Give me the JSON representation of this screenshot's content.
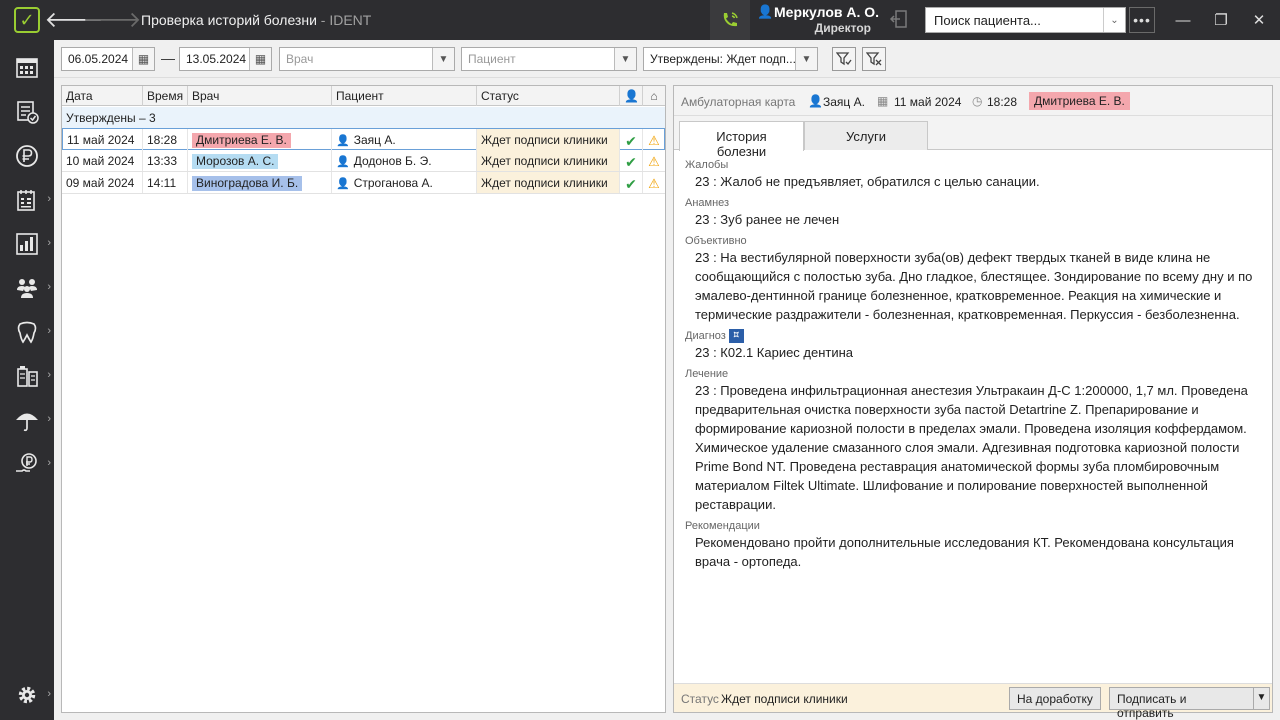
{
  "titlebar": {
    "back_glyph": "🡐",
    "forward_glyph": "🡒",
    "title": "Проверка историй болезни",
    "app_suffix": " - IDENT",
    "user_name": "Меркулов А. О.",
    "user_role": "Директор",
    "search_placeholder": "Поиск пациента...",
    "more_glyph": "•••",
    "min_glyph": "—",
    "max_glyph": "❐",
    "close_glyph": "✕"
  },
  "filters": {
    "date_from": "06.05.2024",
    "date_to": "13.05.2024",
    "dash": "—",
    "doctor_placeholder": "Врач",
    "patient_placeholder": "Пациент",
    "status_value": "Утверждены: Ждет подп..."
  },
  "table": {
    "headers": {
      "date": "Дата",
      "time": "Время",
      "doctor": "Врач",
      "patient": "Пациент",
      "status": "Статус"
    },
    "group": "Утверждены – 3",
    "rows": [
      {
        "date": "11 май 2024",
        "time": "18:28",
        "doctor": "Дмитриева Е. В.",
        "doctor_color": "#f4a7ad",
        "patient": "Заяц А.",
        "status": "Ждет подписи клиники"
      },
      {
        "date": "10 май 2024",
        "time": "13:33",
        "doctor": "Морозов А. С.",
        "doctor_color": "#b5dcf2",
        "patient": "Додонов Б. Э.",
        "status": "Ждет подписи клиники"
      },
      {
        "date": "09 май 2024",
        "time": "14:11",
        "doctor": "Виноградова И. Б.",
        "doctor_color": "#a6c0ea",
        "patient": "Строганова А.",
        "status": "Ждет подписи клиники"
      }
    ]
  },
  "detail": {
    "card_label": "Амбулаторная карта",
    "patient": "Заяц А.",
    "date": "11 май 2024",
    "time": "18:28",
    "doctor": "Дмитриева Е. В.",
    "tabs": [
      "История болезни",
      "Услуги"
    ],
    "sections": [
      {
        "title": "Жалобы",
        "body": "23 : Жалоб не предъявляет, обратился с целью санации."
      },
      {
        "title": "Анамнез",
        "body": "23 : Зуб ранее не лечен"
      },
      {
        "title": "Объективно",
        "body": "23 : На вестибулярной поверхности зуба(ов) дефект твердых тканей в виде клина не сообщающийся с полостью зуба. Дно гладкое, блестящее. Зондирование по всему дну и по эмалево-дентинной границе болезненное, кратковременное. Реакция на химические и термические раздражители - болезненная, кратковременная. Перкуссия - безболезненна."
      },
      {
        "title": "Диагноз",
        "body": "23 : К02.1 Кариес дентина"
      },
      {
        "title": "Лечение",
        "body": "23 : Проведена инфильтрационная анестезия Ультракаин Д-С 1:200000, 1,7 мл. Проведена предварительная очистка поверхности зуба пастой Detartrine Z. Препарирование и формирование кариозной полости в пределах эмали. Проведена изоляция коффердамом. Химическое удаление смазанного слоя эмали. Адгезивная подготовка кариозной полости Prime Bond NT. Проведена реставрация анатомической формы зуба пломбировочным материалом Filtek Ultimate. Шлифование и полирование поверхностей выполненной реставрации."
      },
      {
        "title": "Рекомендации",
        "body": "Рекомендовано пройти дополнительные исследования КТ. Рекомендована консультация врача - ортопеда."
      }
    ],
    "footer": {
      "status_label": "Статус",
      "status_value": "Ждет подписи клиники",
      "rework_button": "На доработку",
      "sign_button": "Подписать и отправить"
    }
  }
}
